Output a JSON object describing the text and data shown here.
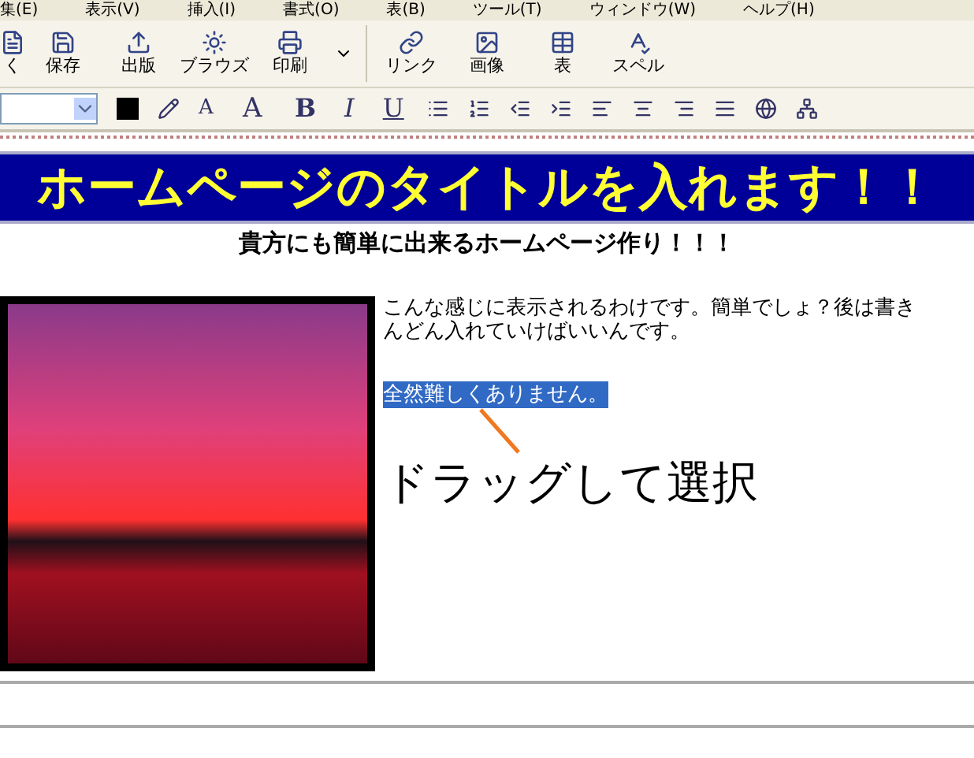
{
  "menu": [
    "集(E)",
    "表示(V)",
    "挿入(I)",
    "書式(O)",
    "表(B)",
    "ツール(T)",
    "ウィンドウ(W)",
    "ヘルプ(H)"
  ],
  "toolbar": [
    {
      "label": "く"
    },
    {
      "label": "保存"
    },
    {
      "label": "出版"
    },
    {
      "label": "ブラウズ"
    },
    {
      "label": "印刷"
    },
    {
      "label": "リンク"
    },
    {
      "label": "画像"
    },
    {
      "label": "表"
    },
    {
      "label": "スペル"
    }
  ],
  "format_toolbar": {
    "font_size_down": "A",
    "font_size_up": "A",
    "bold": "B",
    "italic": "I",
    "underline": "U"
  },
  "page": {
    "banner_title": "ホームページのタイトルを入れます！！",
    "subtitle": "貴方にも簡単に出来るホームページ作り！！！",
    "paragraph_lines": [
      "こんな感じに表示されるわけです。簡単でしょ？後は書き",
      "んどん入れていけばいいんです。"
    ],
    "selected_text": {
      "text": "全然難しくありません。",
      "selected": true
    },
    "annotation": "ドラッグして選択"
  }
}
